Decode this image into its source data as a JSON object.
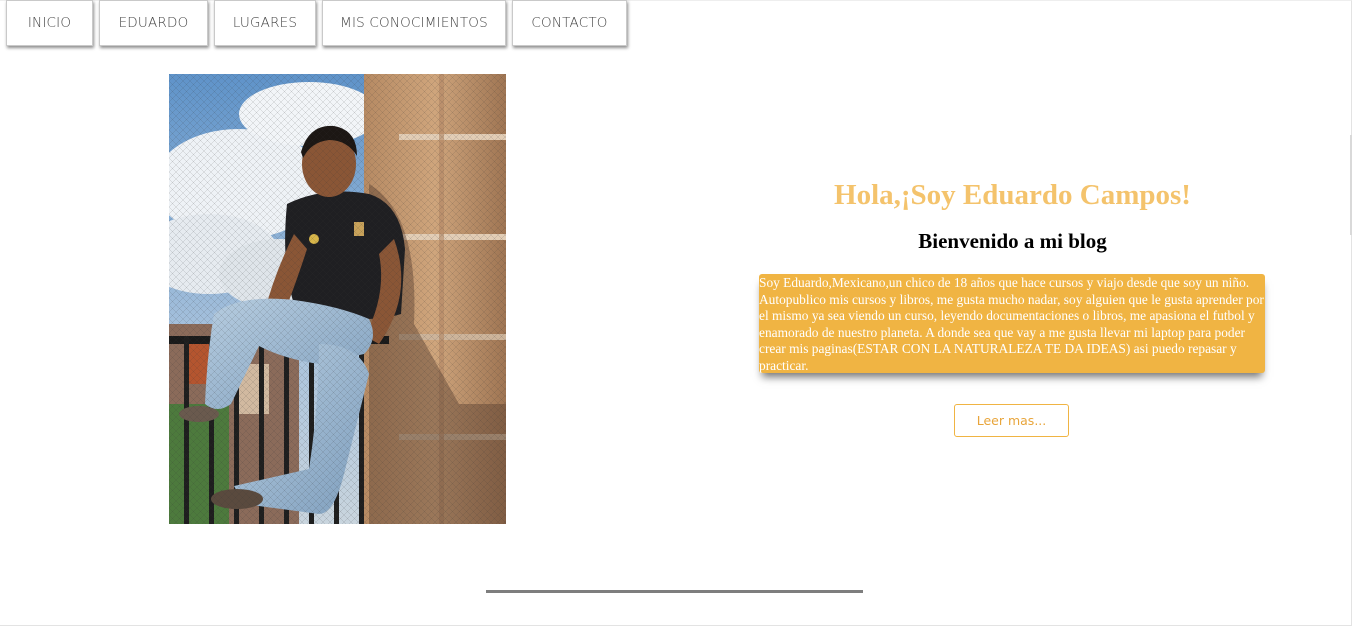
{
  "nav": {
    "items": [
      {
        "label": "INICIO"
      },
      {
        "label": "EDUARDO"
      },
      {
        "label": "LUGARES"
      },
      {
        "label": "MIS CONOCIMIENTOS"
      },
      {
        "label": "CONTACTO"
      }
    ]
  },
  "hero": {
    "title": "Hola,¡Soy Eduardo Campos!",
    "subtitle": "Bienvenido a mi blog",
    "bio": "Soy Eduardo,Mexicano,un chico de 18 años que hace cursos y viajo desde que soy un niño. Autopublico mis cursos y libros, me gusta mucho nadar, soy alguien que le gusta aprender por el mismo ya sea viendo un curso, leyendo documentaciones o libros, me apasiona el futbol y enamorado de nuestro planeta. A donde sea que vay a me gusta llevar mi laptop para poder crear mis paginas(ESTAR CON LA NATURALEZA TE DA IDEAS) asi puedo repasar y practicar.",
    "read_more": "Leer mas..."
  },
  "colors": {
    "accent": "#f0b443",
    "title": "#f4c36c",
    "nav_text": "#444444",
    "divider": "#7e7e7e"
  },
  "photo": {
    "subject": "photo-of-eduardo"
  }
}
